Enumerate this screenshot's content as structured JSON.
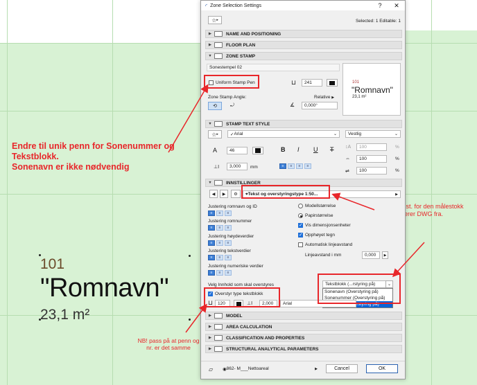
{
  "canvas": {
    "zone_number": "101",
    "zone_name": "\"Romnavn\"",
    "zone_area": "23,1 m²"
  },
  "annotations": {
    "left_note_line1": "Endre til unik penn for Sonenummer og",
    "left_note_line2": "Tekstblokk.",
    "left_note_line3": "Sonenavn er ikke nødvendig",
    "right_note": "NB! Velg inst. for den målestokk du eksporterer DWG fra.",
    "bottom_note": "NB! pass på at penn og nr. er det samme"
  },
  "dialog": {
    "title": "Zone Selection Settings",
    "help_glyph": "?",
    "close_glyph": "✕",
    "selected_info": "Selected: 1 Editable: 1",
    "sections": {
      "name_positioning": "NAME AND POSITIONING",
      "floor_plan": "FLOOR PLAN",
      "zone_stamp": "ZONE STAMP",
      "stamp_text_style": "STAMP TEXT STYLE",
      "innstillinger": "INNSTILLINGER",
      "model": "MODEL",
      "area_calculation": "AREA CALCULATION",
      "classification": "CLASSIFICATION AND PROPERTIES",
      "structural": "STRUCTURAL ANALYTICAL PARAMETERS"
    },
    "zone_stamp": {
      "stamp_name": "Sonestempel 02",
      "uniform_pen_label": "Uniform Stamp Pen",
      "pen_value": "241",
      "angle_label": "Zone Stamp Angle:",
      "relative_label": "Relative",
      "angle_value": "0,000°",
      "preview_num": "101",
      "preview_name": "\"Romnavn\"",
      "preview_area": "23,1 m²"
    },
    "text_style": {
      "font": "Arial",
      "script": "Vestlig",
      "size": "46",
      "line_spacing": "3,000",
      "unit": "mm",
      "pct1": "100",
      "pct2": "100",
      "pct3": "100",
      "pct_sign": "%",
      "bold": "B",
      "italic": "I",
      "underline": "U",
      "strike": "T"
    },
    "innstillinger": {
      "preset": "Tekst og overstyringstype 1:50...",
      "just_labels": [
        "Justering romnavn og ID",
        "Justering romnummer",
        "Justering høydeverdier",
        "Justering tekstverdier",
        "Justering numeriske verdier"
      ],
      "model_size": "Modellstørrelse",
      "paper_size": "Papirstørrelse",
      "show_dims": "Vis dimensjonsenheter",
      "raised": "Opphøyet tegn",
      "auto_spacing": "Automatisk linjeavstand",
      "spacing_label": "Linjeavstand i mm",
      "spacing_value": "0,000",
      "override_content_label": "Velg Innhold som skal overstyres",
      "override_selected": "Tekstblokk (...rstyring på)",
      "override_options": [
        "Sonenavn (Overstyring på)",
        "Sonenummer (Overstyring på)",
        "Tekstblokk (Overstyring på)"
      ],
      "override_textblock_label": "Overstyr type tekstblokk",
      "ov_pen": "120",
      "ov_size": "2,000",
      "ov_font": "Arial"
    },
    "footer": {
      "layer": "862- M___Nettoareal",
      "cancel": "Cancel",
      "ok": "OK"
    }
  },
  "colors": {
    "annotation_red": "#e8262a",
    "canvas_green": "#d8f2d4",
    "selection_blue": "#0a64d8"
  }
}
